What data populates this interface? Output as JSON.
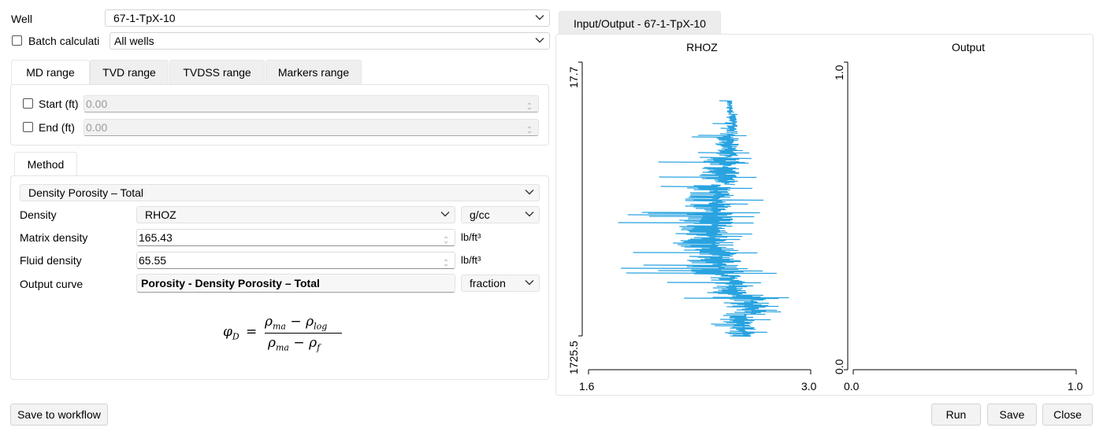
{
  "well": {
    "label": "Well",
    "value": "67-1-TpX-10"
  },
  "batch": {
    "label": "Batch calculati",
    "checked": false,
    "value": "All wells"
  },
  "range_tabs": [
    {
      "label": "MD range",
      "active": true
    },
    {
      "label": "TVD range",
      "active": false
    },
    {
      "label": "TVDSS range",
      "active": false
    },
    {
      "label": "Markers range",
      "active": false
    }
  ],
  "range": {
    "start": {
      "label": "Start (ft)",
      "value": "0.00",
      "checked": false
    },
    "end": {
      "label": "End (ft)",
      "value": "0.00",
      "checked": false
    }
  },
  "method_tab": {
    "label": "Method"
  },
  "method": {
    "selected": "Density Porosity – Total",
    "density": {
      "label": "Density",
      "curve": "RHOZ",
      "unit": "g/cc"
    },
    "matrix_density": {
      "label": "Matrix density",
      "value": "165.43",
      "unit": "lb/ft³"
    },
    "fluid_density": {
      "label": "Fluid density",
      "value": "65.55",
      "unit": "lb/ft³"
    },
    "output_curve": {
      "label": "Output curve",
      "value": "Porosity - Density Porosity – Total",
      "unit": "fraction"
    }
  },
  "formula": {
    "lhs": "φ",
    "lhs_sub": "D",
    "num_a": "ρ",
    "num_a_sub": "ma",
    "num_op": "−",
    "num_b": "ρ",
    "num_b_sub": "log",
    "den_a": "ρ",
    "den_a_sub": "ma",
    "den_op": "−",
    "den_b": "ρ",
    "den_b_sub": "f"
  },
  "io_tab": {
    "label": "Input/Output - 67-1-TpX-10"
  },
  "plots": {
    "rhoz": {
      "title": "RHOZ",
      "depth_top": "17.7",
      "depth_bottom": "1725.5",
      "x_min": "1.6",
      "x_max": "3.0",
      "color": "#29a3e0"
    },
    "output": {
      "title": "Output",
      "y_top": "1.0",
      "y_bottom": "0.0",
      "x_min": "0.0",
      "x_max": "1.0"
    }
  },
  "buttons": {
    "save_workflow": "Save to workflow",
    "run": "Run",
    "save": "Save",
    "close": "Close"
  }
}
